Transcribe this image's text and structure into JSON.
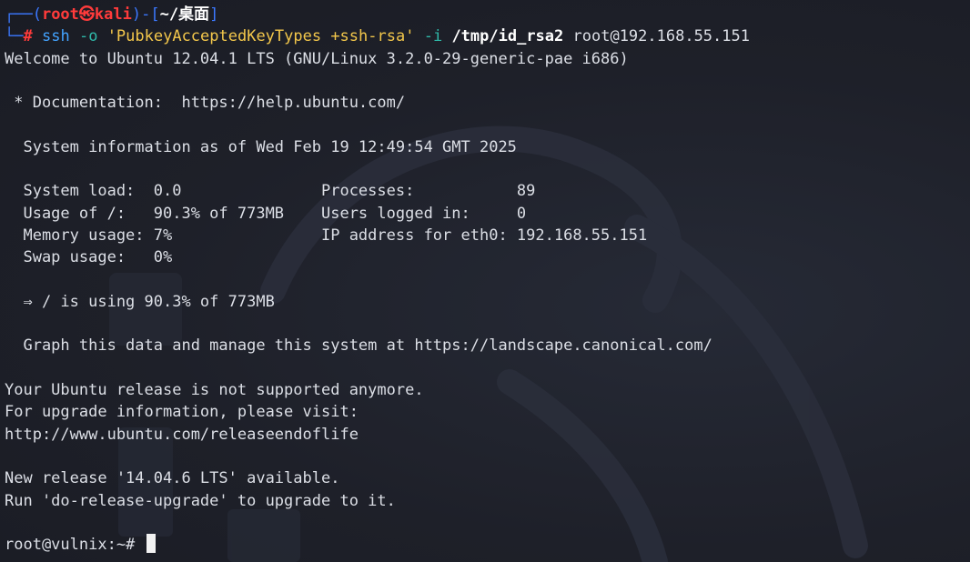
{
  "prompt": {
    "corner_top": "┌──(",
    "user": "root",
    "at": "㉿",
    "host": "kali",
    "sep": ")-[",
    "path": "~/桌面",
    "close": "]",
    "corner_bottom": "└─",
    "hash": "#"
  },
  "command": {
    "program": "ssh",
    "flag_o": "-o",
    "option_value": "'PubkeyAcceptedKeyTypes +ssh-rsa'",
    "flag_i": "-i",
    "key_path": "/tmp/id_rsa2",
    "target": "root@192.168.55.151"
  },
  "output": {
    "welcome": "Welcome to Ubuntu 12.04.1 LTS (GNU/Linux 3.2.0-29-generic-pae i686)",
    "documentation": " * Documentation:  https://help.ubuntu.com/",
    "sysinfo_header": "  System information as of Wed Feb 19 12:49:54 GMT 2025",
    "stats_1": "  System load:  0.0               Processes:           89",
    "stats_2": "  Usage of /:   90.3% of 773MB    Users logged in:     0",
    "stats_3": "  Memory usage: 7%                IP address for eth0: 192.168.55.151",
    "stats_4": "  Swap usage:   0%",
    "warning": "  ⇒ / is using 90.3% of 773MB",
    "graph": "  Graph this data and manage this system at https://landscape.canonical.com/",
    "unsupported": "Your Ubuntu release is not supported anymore.",
    "upgrade_info": "For upgrade information, please visit:",
    "eol_url": "http://www.ubuntu.com/releaseendoflife",
    "new_release": "New release '14.04.6 LTS' available.",
    "run_upgrade": "Run 'do-release-upgrade' to upgrade to it.",
    "remote_prompt": "root@vulnix:~# "
  },
  "colors": {
    "background": "#1d1f28",
    "text": "#dcdfe6",
    "prompt_frame": "#3b78ff",
    "prompt_user": "#ff3b3b",
    "command": "#43a3ff",
    "option": "#2fb9a9",
    "string": "#f3c74b"
  }
}
